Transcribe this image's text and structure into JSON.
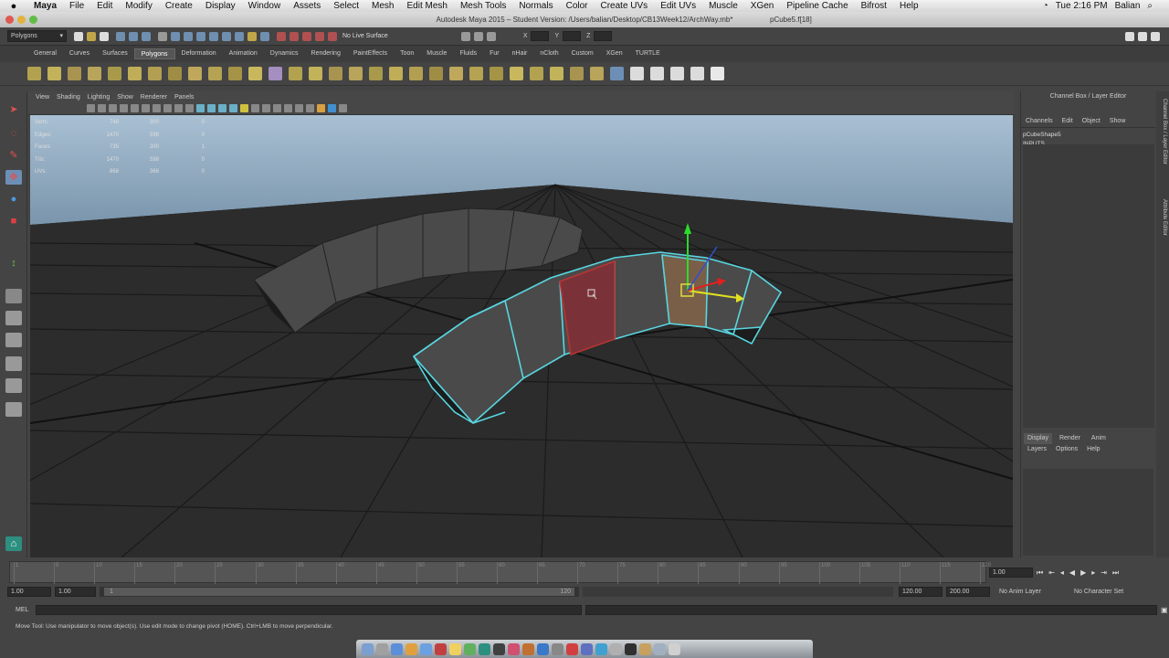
{
  "mac_menubar": {
    "app": "Maya",
    "items": [
      "File",
      "Edit",
      "Modify",
      "Create",
      "Display",
      "Window",
      "Assets",
      "Select",
      "Mesh",
      "Edit Mesh",
      "Mesh Tools",
      "Normals",
      "Color",
      "Create UVs",
      "Edit UVs",
      "Muscle",
      "XGen",
      "Pipeline Cache",
      "Bifrost",
      "Help"
    ],
    "clock": "Tue 2:16 PM",
    "user": "Balian"
  },
  "window_title": "Autodesk Maya 2015 – Student Version: /Users/balian/Desktop/CB13Week12/ArchWay.mb*",
  "window_selection": "pCube5.f[18]",
  "status_line": {
    "mode": "Polygons",
    "live_surface": "No Live Surface",
    "axis_labels": [
      "X",
      "Y",
      "Z"
    ]
  },
  "shelf_tabs": {
    "items": [
      "General",
      "Curves",
      "Surfaces",
      "Polygons",
      "Deformation",
      "Animation",
      "Dynamics",
      "Rendering",
      "PaintEffects",
      "Toon",
      "Muscle",
      "Fluids",
      "Fur",
      "nHair",
      "nCloth",
      "Custom",
      "XGen",
      "TURTLE"
    ],
    "active": "Polygons"
  },
  "panel_menu": [
    "View",
    "Shading",
    "Lighting",
    "Show",
    "Renderer",
    "Panels"
  ],
  "hud": {
    "rows": [
      {
        "label": "Verts:",
        "a": "748",
        "b": "300",
        "c": "0"
      },
      {
        "label": "Edges:",
        "a": "1470",
        "b": "598",
        "c": "0"
      },
      {
        "label": "Faces:",
        "a": "735",
        "b": "300",
        "c": "1"
      },
      {
        "label": "Tris:",
        "a": "1470",
        "b": "598",
        "c": "0"
      },
      {
        "label": "UVs:",
        "a": "868",
        "b": "368",
        "c": "0"
      }
    ]
  },
  "channel_box": {
    "header": "Channel Box / Layer Editor",
    "menu": [
      "Channels",
      "Edit",
      "Object",
      "Show"
    ],
    "shape": "pCubeShape5",
    "inputs_label": "INPUTS",
    "input_node": "polyExtrudeFace4"
  },
  "layer_editor": {
    "tabs": [
      "Display",
      "Render",
      "Anim"
    ],
    "active": "Display",
    "menu": [
      "Layers",
      "Options",
      "Help"
    ]
  },
  "side_tabs": [
    "Channel Box / Layer Editor",
    "Attribute Editor"
  ],
  "time_slider": {
    "ticks": [
      "1",
      "5",
      "10",
      "15",
      "20",
      "25",
      "30",
      "35",
      "40",
      "45",
      "50",
      "55",
      "60",
      "65",
      "70",
      "75",
      "80",
      "85",
      "90",
      "95",
      "100",
      "105",
      "110",
      "115",
      "120"
    ],
    "current_frame": "1.00"
  },
  "range_slider": {
    "start": "1.00",
    "range_start": "1.00",
    "range_inner_start": "1",
    "range_inner_end": "120",
    "range_end": "120.00",
    "end": "200.00",
    "anim_layer": "No Anim Layer",
    "char_set": "No Character Set"
  },
  "command_line": {
    "label": "MEL"
  },
  "help_line": "Move Tool: Use manipulator to move object(s). Use edit mode to change pivot (HOME). Ctrl+LMB to move perpendicular."
}
